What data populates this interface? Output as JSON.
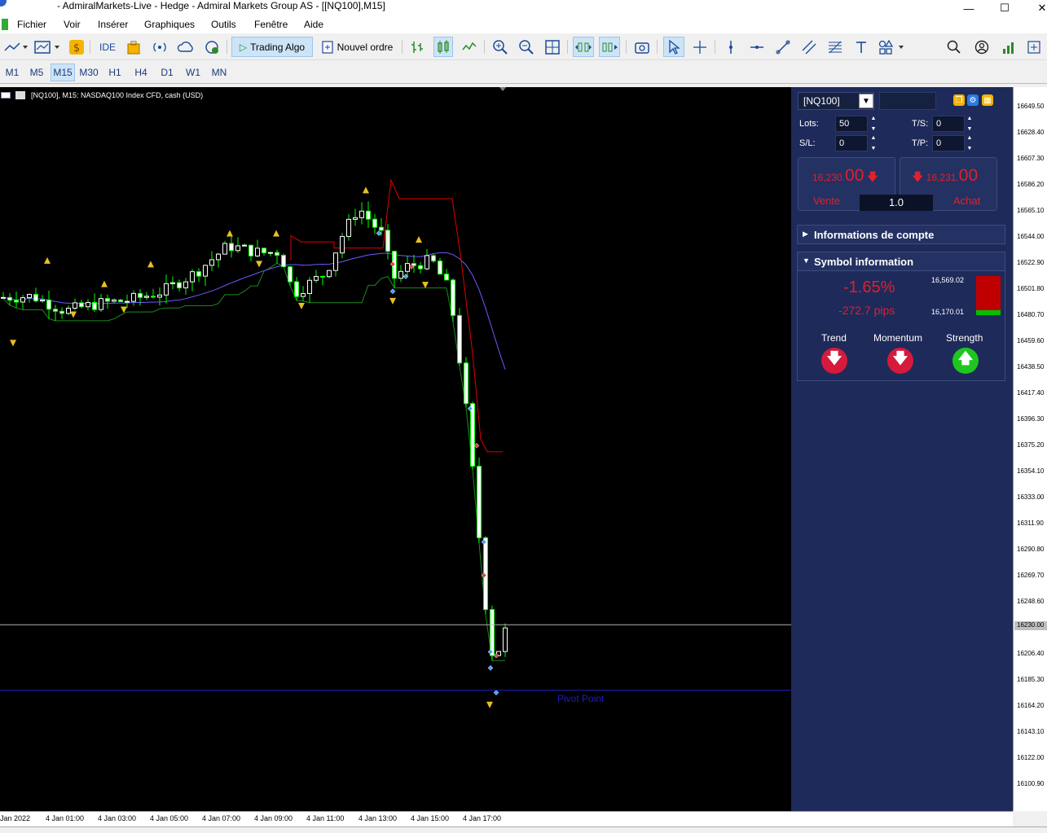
{
  "window": {
    "title": "- AdmiralMarkets-Live - Hedge - Admiral Markets Group AS - [[NQ100],M15]",
    "buttons": {
      "minimize": "—",
      "maximize": "☐",
      "close": "✕"
    }
  },
  "menu": {
    "items": [
      "Fichier",
      "Voir",
      "Insérer",
      "Graphiques",
      "Outils",
      "Fenêtre",
      "Aide"
    ]
  },
  "toolbar": {
    "ide_label": "IDE",
    "trading_algo_label": "Trading Algo",
    "new_order_label": "Nouvel ordre"
  },
  "timeframes": {
    "items": [
      "M1",
      "M5",
      "M15",
      "M30",
      "H1",
      "H4",
      "D1",
      "W1",
      "MN"
    ],
    "active": "M15"
  },
  "chart": {
    "title": "[NQ100], M15:  NASDAQ100 Index CFD, cash (USD)",
    "pivot_label": "Pivot Point",
    "price_labels": [
      "16649.50",
      "16628.40",
      "16607.30",
      "16586.20",
      "16565.10",
      "16544.00",
      "16522.90",
      "16501.80",
      "16480.70",
      "16459.60",
      "16438.50",
      "16417.40",
      "16396.30",
      "16375.20",
      "16354.10",
      "16333.00",
      "16311.90",
      "16290.80",
      "16269.70",
      "16248.60",
      "16227.50",
      "16206.40",
      "16185.30",
      "16164.20",
      "16143.10",
      "16122.00",
      "16100.90"
    ],
    "current_price_label": "16230.00",
    "time_labels": [
      "Jan 2022",
      "4 Jan 01:00",
      "4 Jan 03:00",
      "4 Jan 05:00",
      "4 Jan 07:00",
      "4 Jan 09:00",
      "4 Jan 11:00",
      "4 Jan 13:00",
      "4 Jan 15:00",
      "4 Jan 17:00"
    ],
    "colors": {
      "bull": "#ffffff",
      "bear": "#00ff00",
      "ma_blue": "#6a5cff",
      "ma_red": "#e00000",
      "ma_green": "#1d8a1d",
      "pivot": "#1c1cc8"
    }
  },
  "panel": {
    "symbol": "[NQ100]",
    "lots_label": "Lots:",
    "lots_value": "50",
    "sl_label": "S/L:",
    "sl_value": "0",
    "ts_label": "T/S:",
    "ts_value": "0",
    "tp_label": "T/P:",
    "tp_value": "0",
    "sell": {
      "price_small": "16,230.",
      "price_big": "00",
      "label": "Vente"
    },
    "buy": {
      "price_small": "16,231.",
      "price_big": "00",
      "label": "Achat"
    },
    "quantity": "1.0",
    "account_info_label": "Informations de compte",
    "symbol_info_label": "Symbol information",
    "change_pct": "-1.65%",
    "change_pips": "-272.7 pips",
    "high": "16,569.02",
    "low": "16,170.01",
    "indicators": [
      {
        "label": "Trend",
        "direction": "down"
      },
      {
        "label": "Momentum",
        "direction": "down"
      },
      {
        "label": "Strength",
        "direction": "up"
      }
    ]
  }
}
